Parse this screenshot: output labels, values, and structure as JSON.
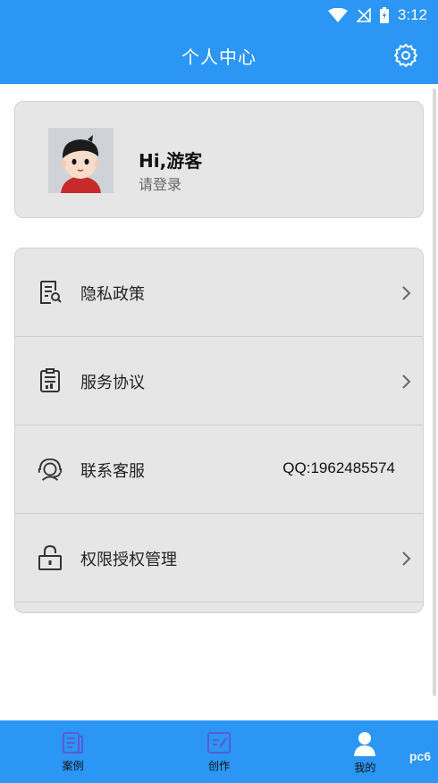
{
  "status_bar": {
    "time": "3:12"
  },
  "header": {
    "title": "个人中心",
    "settings_icon": "gear-icon"
  },
  "profile": {
    "greeting": "Hi,游客",
    "login_prompt": "请登录"
  },
  "menu": {
    "items": [
      {
        "label": "隐私政策",
        "icon": "privacy-doc-icon",
        "has_chevron": true,
        "value": ""
      },
      {
        "label": "服务协议",
        "icon": "agreement-doc-icon",
        "has_chevron": true,
        "value": ""
      },
      {
        "label": "联系客服",
        "icon": "customer-service-icon",
        "has_chevron": false,
        "value": "QQ:1962485574"
      },
      {
        "label": "权限授权管理",
        "icon": "lock-icon",
        "has_chevron": true,
        "value": ""
      }
    ]
  },
  "bottom_nav": {
    "tabs": [
      {
        "label": "案例",
        "icon": "cases-icon",
        "active": false
      },
      {
        "label": "创作",
        "icon": "create-icon",
        "active": false
      },
      {
        "label": "我的",
        "icon": "user-icon",
        "active": true
      }
    ]
  },
  "watermark": {
    "text": "pc6"
  },
  "colors": {
    "primary": "#2b96f3",
    "card": "#e6e6e6",
    "tab_icon": "#5b5bd6"
  }
}
